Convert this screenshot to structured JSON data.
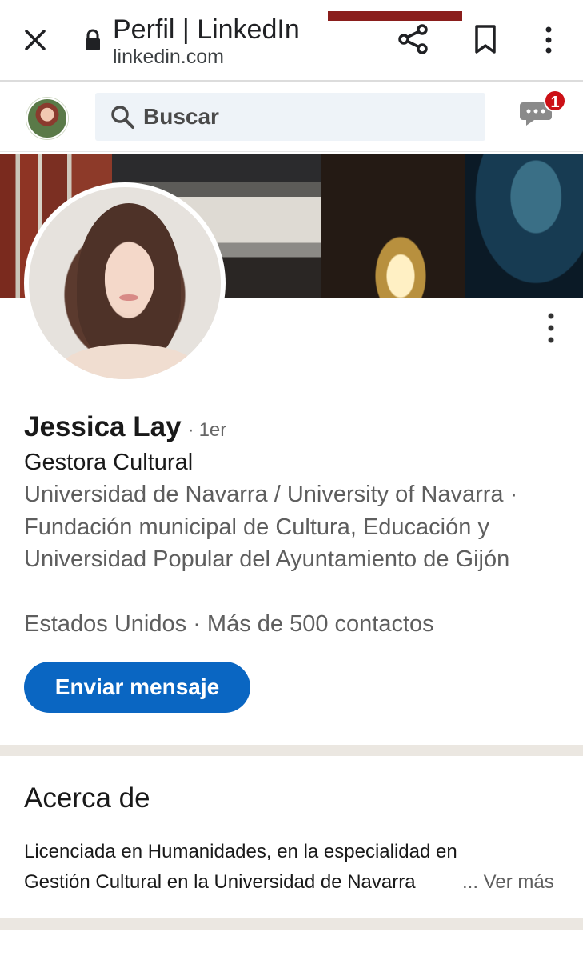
{
  "browser": {
    "title": "Perfil | LinkedIn",
    "url": "linkedin.com",
    "icons": [
      "close-icon",
      "lock-icon",
      "share-icon",
      "bookmark-icon",
      "more-vert-icon"
    ]
  },
  "header": {
    "search_placeholder": "Buscar",
    "messaging_badge_count": "1",
    "icons": [
      "search-icon",
      "messaging-icon"
    ]
  },
  "profile": {
    "name": "Jessica Lay",
    "separator": "·",
    "degree": "1er",
    "headline": "Gestora Cultural",
    "education": "Universidad de Navarra / University of Navarra · Fundación municipal de Cultura, Educación y Universidad Popular del Ayuntamiento de Gijón",
    "location": "Estados Unidos",
    "connections": "Más de 500 contactos",
    "message_button": "Enviar mensaje"
  },
  "about": {
    "title": "Acerca de",
    "text": "Licenciada en Humanidades, en la especialidad en Gestión Cultural en la Universidad de Navarra",
    "see_more": "... Ver más"
  },
  "colors": {
    "primary_blue": "#0a66c2",
    "badge_red": "#cc1016",
    "search_bg": "#eef3f8",
    "divider": "#ebe7e1",
    "secondary_text": "#5e5e5e"
  }
}
